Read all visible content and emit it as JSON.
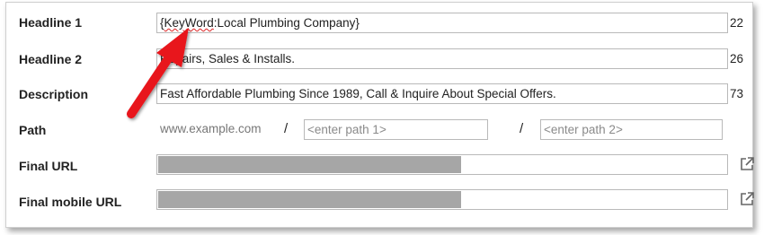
{
  "form": {
    "headline1": {
      "label": "Headline 1",
      "value_prefix": "{",
      "value_keyword": "KeyWord",
      "value_rest": ":Local Plumbing Company}",
      "count": "22"
    },
    "headline2": {
      "label": "Headline 2",
      "value": "Repairs, Sales & Installs.",
      "count": "26"
    },
    "description": {
      "label": "Description",
      "value": "Fast Affordable Plumbing Since 1989, Call & Inquire About Special Offers.",
      "count": "73"
    },
    "path": {
      "label": "Path",
      "domain": "www.example.com",
      "separator": "/",
      "path1_placeholder": "<enter path 1>",
      "path2_placeholder": "<enter path 2>"
    },
    "final_url": {
      "label": "Final URL",
      "value": "",
      "icon": "external-link-icon"
    },
    "final_mobile_url": {
      "label": "Final mobile URL",
      "value": "",
      "icon": "external-link-icon"
    }
  },
  "annotation": {
    "type": "red-arrow",
    "color": "#e8141b"
  },
  "colors": {
    "redaction": "#a6a6a6",
    "border": "#b9b9b9",
    "squiggle": "#d22222"
  }
}
